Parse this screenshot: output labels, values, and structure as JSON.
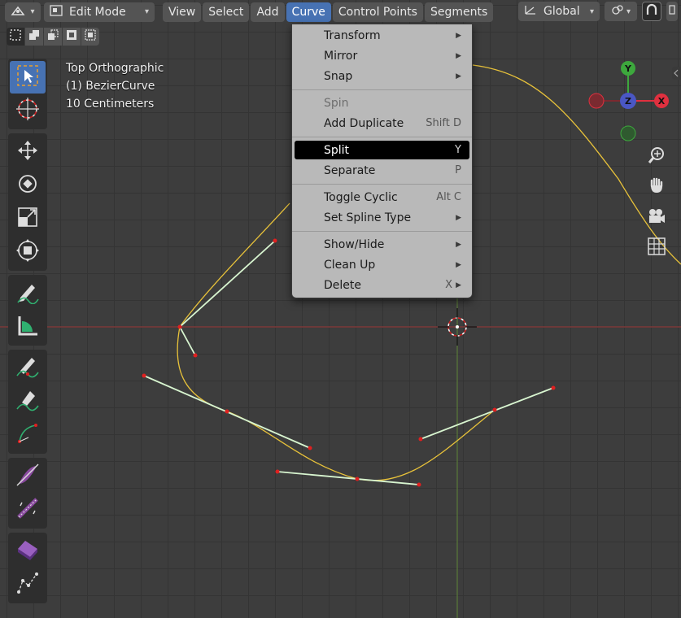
{
  "header": {
    "editor_icon": "editor-type-icon",
    "mode": "Edit Mode",
    "menus": [
      "View",
      "Select",
      "Add",
      "Curve",
      "Control Points",
      "Segments"
    ],
    "active_menu": "Curve",
    "orientation": "Global"
  },
  "overlay": {
    "view_name": "Top Orthographic",
    "object_name": "(1) BezierCurve",
    "scale": "10 Centimeters"
  },
  "gizmo": {
    "y_label": "Y",
    "z_label": "Z",
    "x_label": "X",
    "colors": {
      "x": "#e0303f",
      "y": "#3da83d",
      "z": "#4a57c4",
      "neg": "#7a2a30"
    }
  },
  "curve_menu": {
    "items": [
      {
        "label": "Transform",
        "shortcut": "",
        "submenu": true
      },
      {
        "label": "Mirror",
        "shortcut": "",
        "submenu": true
      },
      {
        "label": "Snap",
        "shortcut": "",
        "submenu": true
      },
      {
        "label": "Spin",
        "shortcut": "",
        "submenu": false,
        "disabled": true
      },
      {
        "label": "Add Duplicate",
        "shortcut": "Shift D",
        "submenu": false
      },
      {
        "label": "Split",
        "shortcut": "Y",
        "submenu": false,
        "highlighted": true
      },
      {
        "label": "Separate",
        "shortcut": "P",
        "submenu": false
      },
      {
        "label": "Toggle Cyclic",
        "shortcut": "Alt C",
        "submenu": false
      },
      {
        "label": "Set Spline Type",
        "shortcut": "",
        "submenu": true
      },
      {
        "label": "Show/Hide",
        "shortcut": "",
        "submenu": true
      },
      {
        "label": "Clean Up",
        "shortcut": "",
        "submenu": true
      },
      {
        "label": "Delete",
        "shortcut": "X",
        "submenu": true
      }
    ]
  },
  "colors": {
    "accent": "#4772b3",
    "curve": "#e8c23a",
    "handle": "#d8f5d0",
    "control_point": "#e02020"
  }
}
